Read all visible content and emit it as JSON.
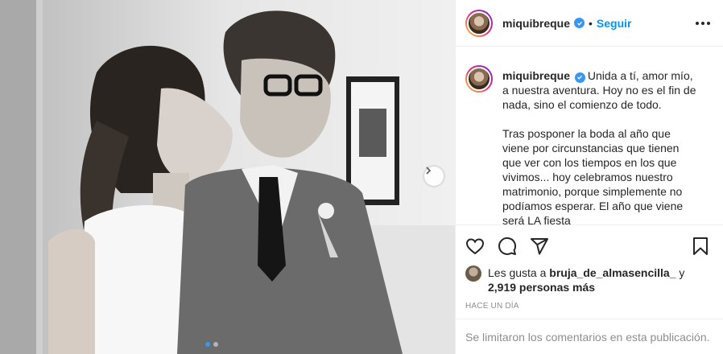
{
  "post": {
    "username": "miquibreque",
    "follow_label": "Seguir",
    "bullet": "•",
    "caption_line1": "Unida a tí, amor mío,",
    "caption_rest": "a nuestra aventura. Hoy no es el fin de\nnada, sino el comienzo de todo.\n\nTras posponer la boda al año que\nviene por circunstancias que tienen\nque ver con los tiempos en los que\nvivimos... hoy celebramos nuestro\nmatrimonio, porque simplemente no\npodíamos esperar. El año que viene\nserá LA fiesta",
    "likes_prefix": "Les gusta a",
    "likes_user": "bruja_de_almasencilla_",
    "likes_and": "y",
    "likes_others": "2,919 personas más",
    "timestamp": "Hace un día",
    "comments_disabled": "Se limitaron los comentarios en esta publicación."
  },
  "carousel": {
    "slide_count": 2,
    "active_slide": 1
  },
  "colors": {
    "accent": "#0095f6",
    "verified": "#3897f0",
    "border": "#efefef",
    "muted": "#8e8e8e"
  },
  "icons": [
    "verified-icon",
    "heart-icon",
    "comment-icon",
    "share-icon",
    "bookmark-icon",
    "more-options-icon",
    "chevron-right-icon"
  ]
}
